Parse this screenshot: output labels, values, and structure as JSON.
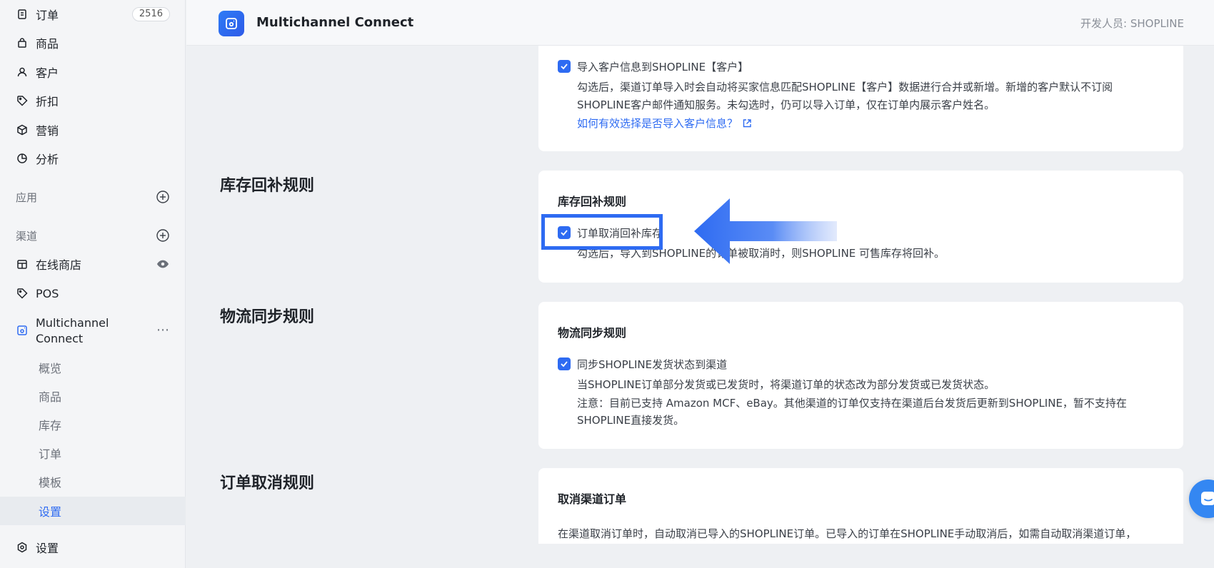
{
  "sidebar": {
    "nav": [
      {
        "label": "订单",
        "icon": "orders-icon",
        "badge": "2516"
      },
      {
        "label": "商品",
        "icon": "bag-icon"
      },
      {
        "label": "客户",
        "icon": "user-icon"
      },
      {
        "label": "折扣",
        "icon": "tag-icon"
      },
      {
        "label": "营销",
        "icon": "cube-icon"
      },
      {
        "label": "分析",
        "icon": "pie-chart-icon"
      }
    ],
    "apps_label": "应用",
    "channels_label": "渠道",
    "channels": [
      {
        "label": "在线商店",
        "icon": "store-icon"
      },
      {
        "label": "POS",
        "icon": "pos-tag-icon"
      },
      {
        "label": "Multichannel Connect",
        "icon": "multichannel-icon"
      }
    ],
    "sub_items": [
      "概览",
      "商品",
      "库存",
      "订单",
      "模板",
      "设置"
    ],
    "active_sub": "设置",
    "settings_label": "设置"
  },
  "header": {
    "app_title": "Multichannel Connect",
    "developer": "开发人员: SHOPLINE"
  },
  "customer_card": {
    "checkbox_label": "导入客户信息到SHOPLINE【客户】",
    "desc_line1": "勾选后，渠道订单导入时会自动将买家信息匹配SHOPLINE【客户】数据进行合并或新增。新增的客户默认不订阅",
    "desc_line2": "SHOPLINE客户邮件通知服务。未勾选时，仍可以导入订单，仅在订单内展示客户姓名。",
    "help_link": "如何有效选择是否导入客户信息？"
  },
  "inventory": {
    "section_title": "库存回补规则",
    "card_title": "库存回补规则",
    "checkbox_label": "订单取消回补库存",
    "desc": "勾选后，导入到SHOPLINE的订单被取消时，则SHOPLINE 可售库存将回补。"
  },
  "logistics": {
    "section_title": "物流同步规则",
    "card_title": "物流同步规则",
    "checkbox_label": "同步SHOPLINE发货状态到渠道",
    "desc_line1": "当SHOPLINE订单部分发货或已发货时，将渠道订单的状态改为部分发货或已发货状态。",
    "desc_line2": "注意：目前已支持 Amazon MCF、eBay。其他渠道的订单仅支持在渠道后台发货后更新到SHOPLINE，暂不支持在",
    "desc_line3": "SHOPLINE直接发货。"
  },
  "cancel": {
    "section_title": "订单取消规则",
    "card_title": "取消渠道订单",
    "desc": "在渠道取消订单时，自动取消已导入的SHOPLINE订单。已导入的订单在SHOPLINE手动取消后，如需自动取消渠道订单，"
  },
  "colors": {
    "accent": "#2e6bf2",
    "sidebar_bg": "#f4f5f7",
    "page_bg": "#eef0f3"
  }
}
